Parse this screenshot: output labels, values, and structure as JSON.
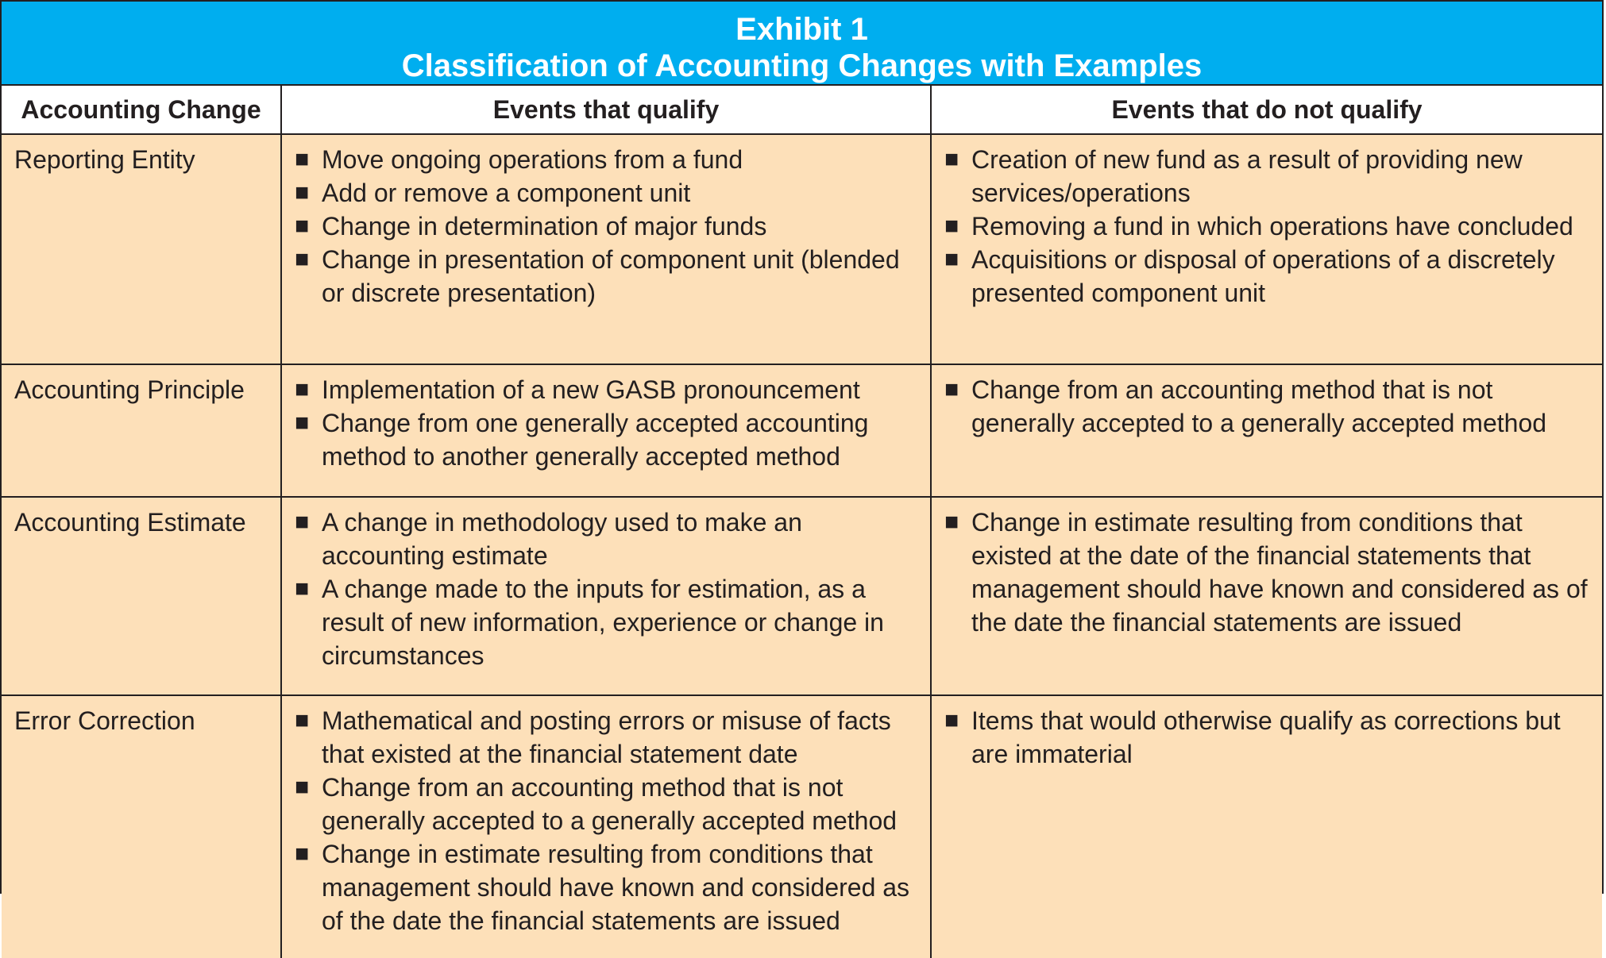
{
  "header": {
    "title_line1": "Exhibit 1",
    "title_line2": "Classification of Accounting Changes with Examples"
  },
  "columns": {
    "col1": "Accounting Change",
    "col2": "Events that qualify",
    "col3": "Events that do not qualify"
  },
  "bullet_glyph": "■",
  "rows": [
    {
      "label": "Reporting Entity",
      "qualify": [
        "Move ongoing operations from a fund",
        "Add or remove a component unit",
        "Change in determination of major funds",
        "Change in presentation of component unit (blended or discrete presentation)"
      ],
      "not_qualify": [
        "Creation of new fund as a result of providing new services/operations",
        "Removing a fund in which operations have concluded",
        "Acquisitions or disposal of operations of a discretely presented component unit"
      ]
    },
    {
      "label": "Accounting Principle",
      "qualify": [
        "Implementation of a new GASB pronouncement",
        "Change from one generally accepted accounting method to another generally accepted method"
      ],
      "not_qualify": [
        "Change from an accounting method that is not generally accepted to a generally accepted method"
      ]
    },
    {
      "label": "Accounting Estimate",
      "qualify": [
        "A change in methodology used to make an accounting estimate",
        "A change made to the inputs for estimation, as a result of new information, experience or change in circumstances"
      ],
      "not_qualify": [
        "Change in estimate resulting from conditions that existed at the date of the financial statements that management should have known and considered as of the date the financial statements are issued"
      ]
    },
    {
      "label": "Error Correction",
      "qualify": [
        "Mathematical and posting errors or misuse of facts that existed at the financial statement date",
        "Change from an accounting method that is not generally accepted to a generally accepted method",
        "Change in estimate resulting from conditions that management should have known and considered as of the date the financial statements are issued"
      ],
      "not_qualify": [
        "Items that would otherwise qualify as corrections but are immaterial"
      ]
    }
  ],
  "colors": {
    "header_bg": "#00aeef",
    "header_text": "#ffffff",
    "cell_bg": "#fde0b9",
    "border": "#231f20"
  }
}
